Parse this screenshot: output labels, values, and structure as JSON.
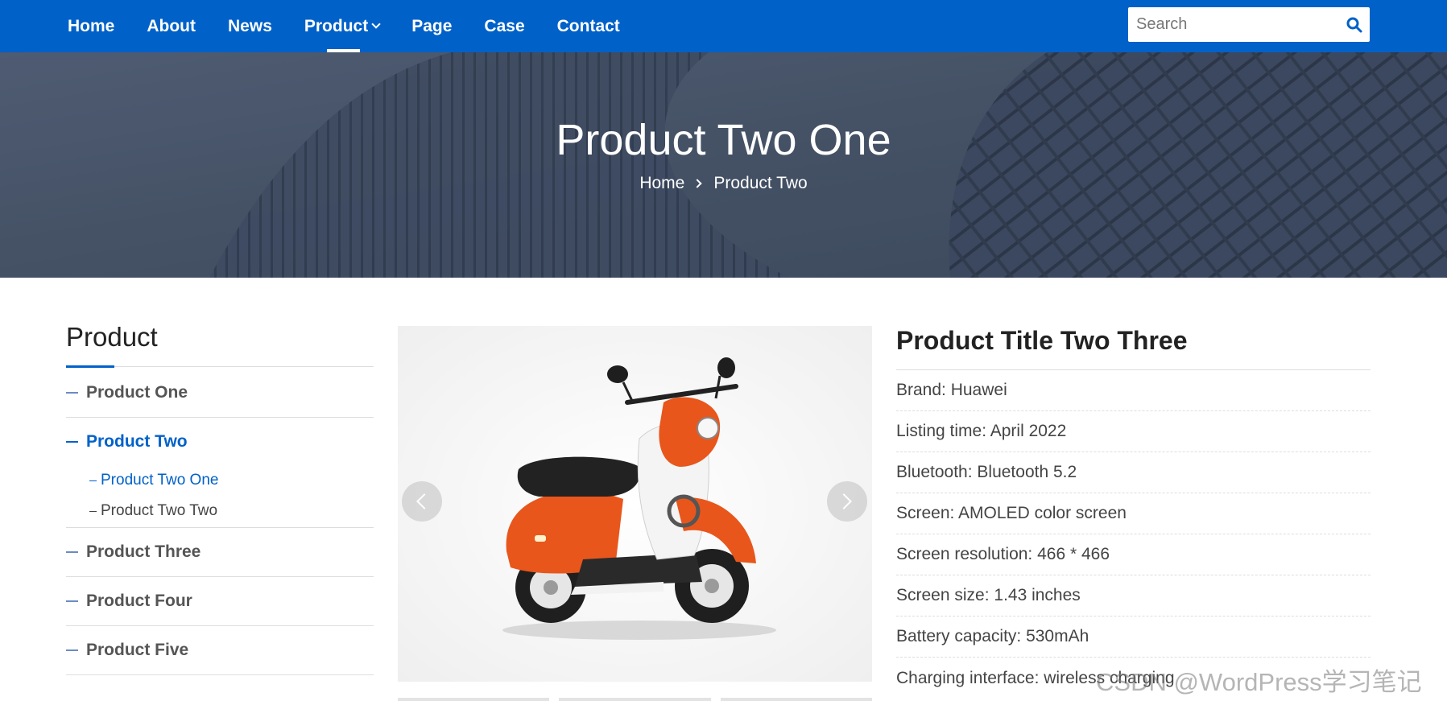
{
  "nav": {
    "items": [
      "Home",
      "About",
      "News",
      "Product",
      "Page",
      "Case",
      "Contact"
    ],
    "active_index": 3,
    "search_placeholder": "Search"
  },
  "hero": {
    "title": "Product Two One",
    "breadcrumb": [
      "Home",
      "Product Two"
    ]
  },
  "sidebar": {
    "title": "Product",
    "categories": [
      {
        "label": "Product One"
      },
      {
        "label": "Product Two",
        "active": true,
        "children": [
          {
            "label": "Product Two One",
            "active": true
          },
          {
            "label": "Product Two Two"
          }
        ]
      },
      {
        "label": "Product Three"
      },
      {
        "label": "Product Four"
      },
      {
        "label": "Product Five"
      }
    ]
  },
  "product": {
    "title": "Product Title Two Three",
    "specs": [
      "Brand: Huawei",
      "Listing time: April 2022",
      "Bluetooth: Bluetooth 5.2",
      "Screen: AMOLED color screen",
      "Screen resolution: 466 * 466",
      "Screen size: 1.43 inches",
      "Battery capacity: 530mAh",
      "Charging interface: wireless charging"
    ]
  },
  "watermark": "CSDN @WordPress学习笔记",
  "colors": {
    "primary": "#0061c9",
    "accent": "#e8561c"
  }
}
